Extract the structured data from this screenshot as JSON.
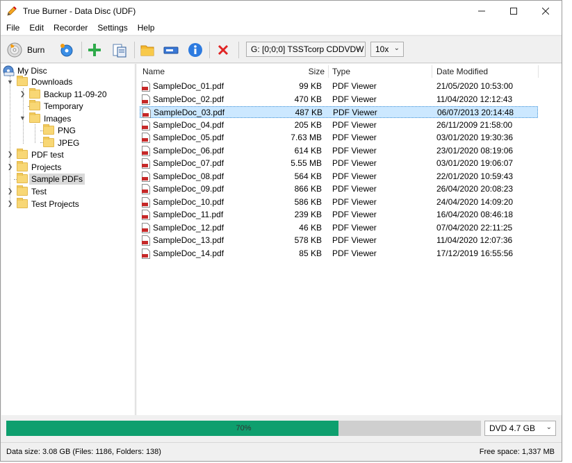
{
  "window": {
    "title": "True Burner - Data Disc (UDF)"
  },
  "menu": [
    "File",
    "Edit",
    "Recorder",
    "Settings",
    "Help"
  ],
  "toolbar": {
    "burn_label": "Burn",
    "drive": "G:  [0;0;0] TSSTcorp CDDVDW",
    "speed": "10x"
  },
  "tree": {
    "root": "My Disc",
    "items": [
      {
        "label": "Downloads"
      },
      {
        "label": "Backup 11-09-20"
      },
      {
        "label": "Temporary"
      },
      {
        "label": "Images"
      },
      {
        "label": "PNG"
      },
      {
        "label": "JPEG"
      },
      {
        "label": "PDF test"
      },
      {
        "label": "Projects"
      },
      {
        "label": "Sample PDFs"
      },
      {
        "label": "Test"
      },
      {
        "label": "Test Projects"
      }
    ]
  },
  "list": {
    "columns": [
      "Name",
      "Size",
      "Type",
      "Date Modified"
    ],
    "rows": [
      {
        "name": "SampleDoc_01.pdf",
        "size": "99 KB",
        "type": "PDF Viewer",
        "date": "21/05/2020 10:53:00"
      },
      {
        "name": "SampleDoc_02.pdf",
        "size": "470 KB",
        "type": "PDF Viewer",
        "date": "11/04/2020 12:12:43"
      },
      {
        "name": "SampleDoc_03.pdf",
        "size": "487 KB",
        "type": "PDF Viewer",
        "date": "06/07/2013 20:14:48"
      },
      {
        "name": "SampleDoc_04.pdf",
        "size": "205 KB",
        "type": "PDF Viewer",
        "date": "26/11/2009 21:58:00"
      },
      {
        "name": "SampleDoc_05.pdf",
        "size": "7.63 MB",
        "type": "PDF Viewer",
        "date": "03/01/2020 19:30:36"
      },
      {
        "name": "SampleDoc_06.pdf",
        "size": "614 KB",
        "type": "PDF Viewer",
        "date": "23/01/2020 08:19:06"
      },
      {
        "name": "SampleDoc_07.pdf",
        "size": "5.55 MB",
        "type": "PDF Viewer",
        "date": "03/01/2020 19:06:07"
      },
      {
        "name": "SampleDoc_08.pdf",
        "size": "564 KB",
        "type": "PDF Viewer",
        "date": "22/01/2020 10:59:43"
      },
      {
        "name": "SampleDoc_09.pdf",
        "size": "866 KB",
        "type": "PDF Viewer",
        "date": "26/04/2020 20:08:23"
      },
      {
        "name": "SampleDoc_10.pdf",
        "size": "586 KB",
        "type": "PDF Viewer",
        "date": "24/04/2020 14:09:20"
      },
      {
        "name": "SampleDoc_11.pdf",
        "size": "239 KB",
        "type": "PDF Viewer",
        "date": "16/04/2020 08:46:18"
      },
      {
        "name": "SampleDoc_12.pdf",
        "size": "46 KB",
        "type": "PDF Viewer",
        "date": "07/04/2020 22:11:25"
      },
      {
        "name": "SampleDoc_13.pdf",
        "size": "578 KB",
        "type": "PDF Viewer",
        "date": "11/04/2020 12:07:36"
      },
      {
        "name": "SampleDoc_14.pdf",
        "size": "85 KB",
        "type": "PDF Viewer",
        "date": "17/12/2019 16:55:56"
      }
    ]
  },
  "progress": {
    "label": "70%",
    "fraction": 0.7,
    "disc_type": "DVD 4.7 GB"
  },
  "status": {
    "left": "Data size: 3.08 GB (Files: 1186, Folders: 138)",
    "right": "Free space: 1,337 MB"
  },
  "colors": {
    "progress_fill": "#0e9f6e",
    "selection": "#cce8ff",
    "folder": "#f8d775",
    "pdf_red": "#c62828"
  }
}
